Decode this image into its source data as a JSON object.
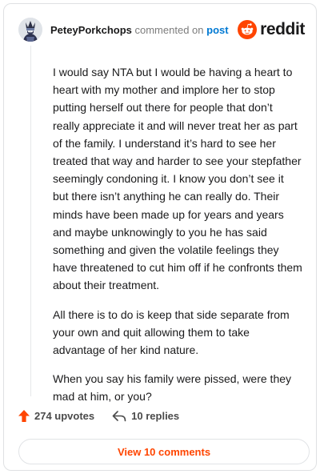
{
  "header": {
    "username": "PeteyPorkchops",
    "action_text": "commented on",
    "target_link": "post",
    "brand_name": "reddit",
    "avatar_icon": "wizard-avatar-icon",
    "brand_icon": "reddit-alien-icon"
  },
  "comment": {
    "paragraphs": [
      "I would say NTA but I would be having a heart to heart with my mother and implore her to stop putting herself out there for people that don’t really appreciate it and will never treat her as part of the family. I understand it’s hard to see her treated that way and harder to see your stepfather seemingly condoning it. I know you don’t see it but there isn’t anything he can really do. Their minds have been made up for years and years and maybe unknowingly to you he has said something and given the volatile feelings they have threatened to cut him off if he confronts them about their treatment.",
      "All there is to do is keep that side separate from your own and quit allowing them to take advantage of her kind nature.",
      "When you say his family were pissed, were they mad at him, or you?"
    ]
  },
  "actions": {
    "upvotes_label": "274 upvotes",
    "replies_label": "10 replies",
    "upvote_icon": "upvote-arrow-icon",
    "reply_icon": "reply-arrow-icon"
  },
  "footer": {
    "view_comments_label": "View 10 comments"
  },
  "colors": {
    "brand": "#ff4500",
    "link": "#0079d3",
    "text": "#1a1a1b",
    "muted": "#7c7c7c",
    "border": "#dfe1e3"
  }
}
